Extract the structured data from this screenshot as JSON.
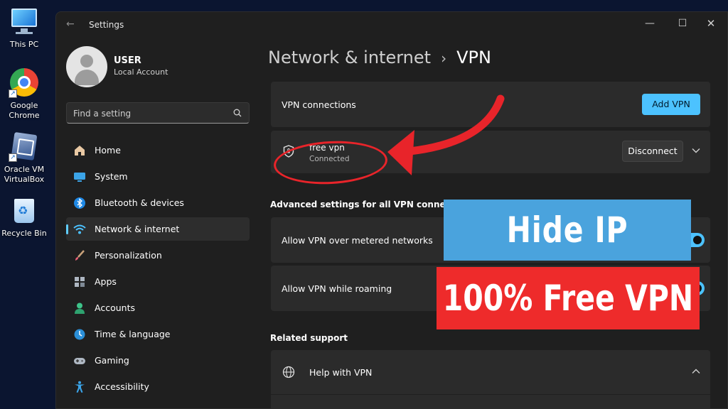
{
  "desktop": {
    "icons": [
      {
        "label": "This PC",
        "icon": "monitor-icon"
      },
      {
        "label": "Google\nChrome",
        "icon": "chrome-icon"
      },
      {
        "label": "Oracle VM\nVirtualBox",
        "icon": "virtualbox-icon"
      },
      {
        "label": "Recycle Bin",
        "icon": "recycle-bin-icon"
      }
    ],
    "labels": {
      "this_pc": "This PC",
      "chrome_1": "Google",
      "chrome_2": "Chrome",
      "vbox_1": "Oracle VM",
      "vbox_2": "VirtualBox",
      "bin": "Recycle Bin"
    }
  },
  "window": {
    "title": "Settings",
    "controls": {
      "minimize": "—",
      "maximize": "☐",
      "close": "✕"
    }
  },
  "profile": {
    "name": "USER",
    "account_type": "Local Account"
  },
  "search": {
    "placeholder": "Find a setting",
    "value": ""
  },
  "sidebar": {
    "items": [
      {
        "label": "Home",
        "icon": "home-icon",
        "active": false
      },
      {
        "label": "System",
        "icon": "system-icon",
        "active": false
      },
      {
        "label": "Bluetooth & devices",
        "icon": "bluetooth-icon",
        "active": false
      },
      {
        "label": "Network & internet",
        "icon": "wifi-icon",
        "active": true
      },
      {
        "label": "Personalization",
        "icon": "brush-icon",
        "active": false
      },
      {
        "label": "Apps",
        "icon": "apps-icon",
        "active": false
      },
      {
        "label": "Accounts",
        "icon": "accounts-icon",
        "active": false
      },
      {
        "label": "Time & language",
        "icon": "globe-clock-icon",
        "active": false
      },
      {
        "label": "Gaming",
        "icon": "gamepad-icon",
        "active": false
      },
      {
        "label": "Accessibility",
        "icon": "accessibility-icon",
        "active": false
      }
    ]
  },
  "breadcrumb": {
    "parent": "Network & internet",
    "separator": "›",
    "current": "VPN"
  },
  "vpn": {
    "connections_label": "VPN connections",
    "add_button": "Add VPN",
    "connection": {
      "name": "free vpn",
      "status": "Connected",
      "disconnect_button": "Disconnect"
    }
  },
  "advanced": {
    "title": "Advanced settings for all VPN connections",
    "metered_label": "Allow VPN over metered networks",
    "metered_on": true,
    "roaming_label": "Allow VPN while roaming",
    "roaming_on": true
  },
  "related": {
    "title": "Related support",
    "help_label": "Help with VPN"
  },
  "overlay": {
    "hide_ip": "Hide IP",
    "free_vpn": "100% Free VPN"
  },
  "colors": {
    "accent": "#4cc2ff",
    "banner_blue": "#4aa3dd",
    "banner_red": "#ee2b2b",
    "annotation_red": "#e8242a"
  }
}
